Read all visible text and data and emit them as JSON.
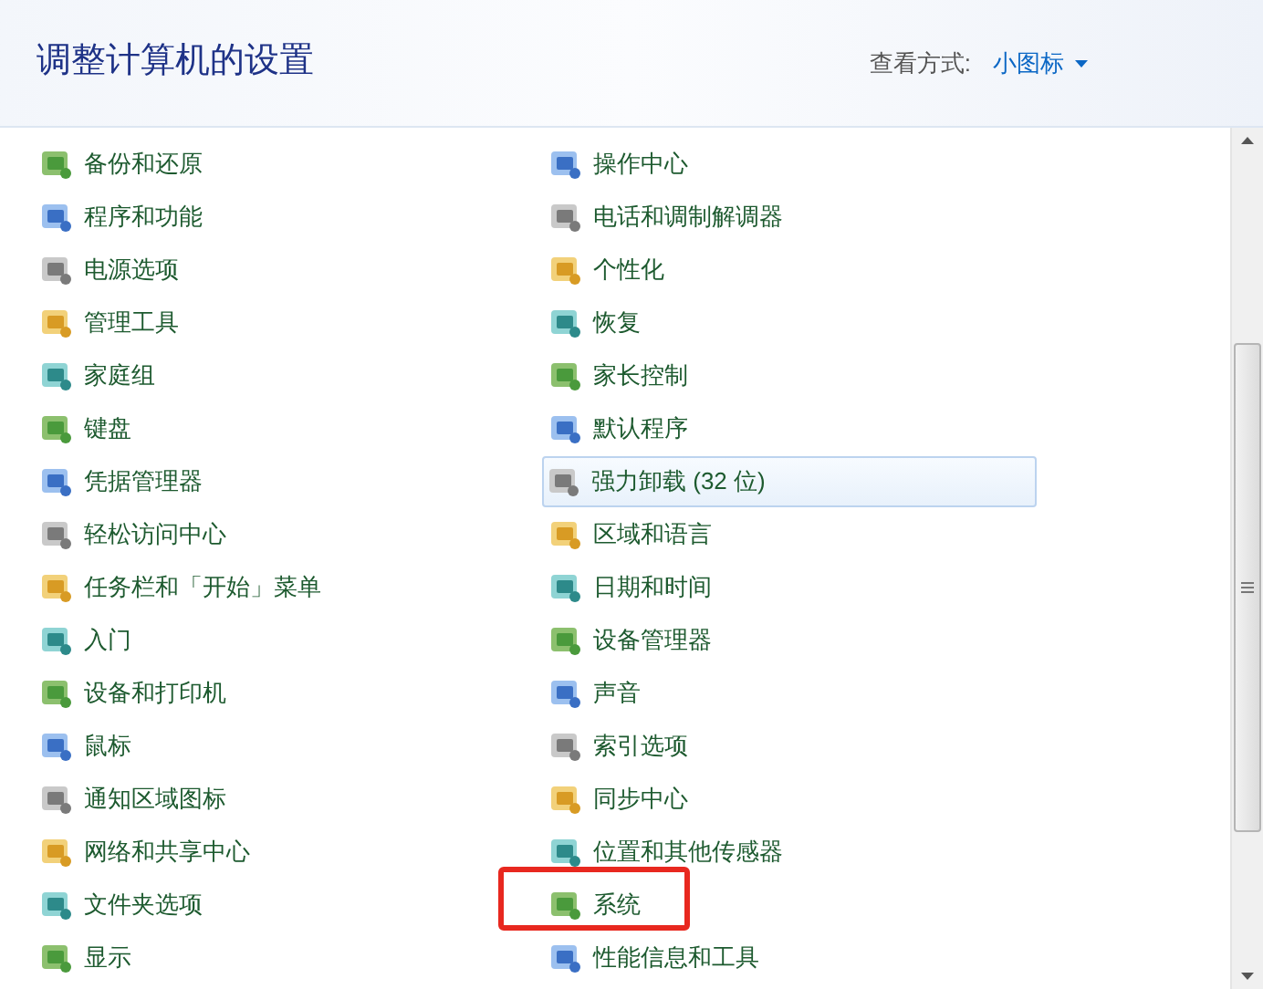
{
  "header": {
    "title": "调整计算机的设置",
    "view_label": "查看方式:",
    "view_value": "小图标"
  },
  "columns": [
    {
      "items": [
        {
          "label": "备份和还原",
          "hovered": false,
          "highlighted": false
        },
        {
          "label": "程序和功能",
          "hovered": false,
          "highlighted": false
        },
        {
          "label": "电源选项",
          "hovered": false,
          "highlighted": false
        },
        {
          "label": "管理工具",
          "hovered": false,
          "highlighted": false
        },
        {
          "label": "家庭组",
          "hovered": false,
          "highlighted": false
        },
        {
          "label": "键盘",
          "hovered": false,
          "highlighted": false
        },
        {
          "label": "凭据管理器",
          "hovered": false,
          "highlighted": false
        },
        {
          "label": "轻松访问中心",
          "hovered": false,
          "highlighted": false
        },
        {
          "label": "任务栏和「开始」菜单",
          "hovered": false,
          "highlighted": false
        },
        {
          "label": "入门",
          "hovered": false,
          "highlighted": false
        },
        {
          "label": "设备和打印机",
          "hovered": false,
          "highlighted": false
        },
        {
          "label": "鼠标",
          "hovered": false,
          "highlighted": false
        },
        {
          "label": "通知区域图标",
          "hovered": false,
          "highlighted": false
        },
        {
          "label": "网络和共享中心",
          "hovered": false,
          "highlighted": false
        },
        {
          "label": "文件夹选项",
          "hovered": false,
          "highlighted": false
        },
        {
          "label": "显示",
          "hovered": false,
          "highlighted": false
        }
      ]
    },
    {
      "items": [
        {
          "label": "操作中心",
          "hovered": false,
          "highlighted": false
        },
        {
          "label": "电话和调制解调器",
          "hovered": false,
          "highlighted": false
        },
        {
          "label": "个性化",
          "hovered": false,
          "highlighted": false
        },
        {
          "label": "恢复",
          "hovered": false,
          "highlighted": false
        },
        {
          "label": "家长控制",
          "hovered": false,
          "highlighted": false
        },
        {
          "label": "默认程序",
          "hovered": false,
          "highlighted": false
        },
        {
          "label": "强力卸载 (32 位)",
          "hovered": true,
          "highlighted": false
        },
        {
          "label": "区域和语言",
          "hovered": false,
          "highlighted": false
        },
        {
          "label": "日期和时间",
          "hovered": false,
          "highlighted": false
        },
        {
          "label": "设备管理器",
          "hovered": false,
          "highlighted": false
        },
        {
          "label": "声音",
          "hovered": false,
          "highlighted": false
        },
        {
          "label": "索引选项",
          "hovered": false,
          "highlighted": false
        },
        {
          "label": "同步中心",
          "hovered": false,
          "highlighted": false
        },
        {
          "label": "位置和其他传感器",
          "hovered": false,
          "highlighted": false
        },
        {
          "label": "系统",
          "hovered": false,
          "highlighted": true
        },
        {
          "label": "性能信息和工具",
          "hovered": false,
          "highlighted": false
        }
      ]
    }
  ]
}
